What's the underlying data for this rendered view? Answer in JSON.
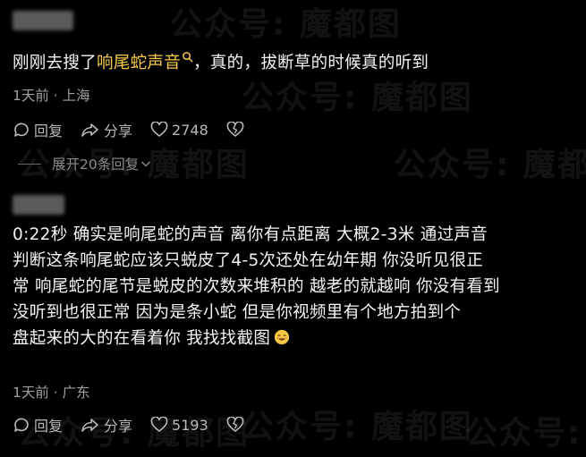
{
  "comments": [
    {
      "text_before": "刚刚去搜了",
      "link_text": "响尾蛇声音",
      "text_after": "，真的，拔断草的时候真的听到",
      "meta": "1天前 · 上海",
      "reply_label": "回复",
      "share_label": "分享",
      "like_count": "2748",
      "expand_label": "展开20条回复"
    },
    {
      "lines": [
        "0:22秒  确实是响尾蛇的声音  离你有点距离  大概2-3米  通过声音",
        "判断这条响尾蛇应该只蜕皮了4-5次还处在幼年期  你没听见很正",
        "常  响尾蛇的尾节是蜕皮的次数来堆积的  越老的就越响  你没有看到",
        "没听到也很正常  因为是条小蛇  但是你视频里有个地方拍到个",
        "盘起来的大的在看着你  我找找截图"
      ],
      "meta": "1天前 · 广东",
      "reply_label": "回复",
      "share_label": "分享",
      "like_count": "5193"
    }
  ],
  "watermark": "公众号: 魔都图",
  "colors": {
    "highlight": "#f6c84a",
    "meta": "#a0a0a0",
    "background": "#000000"
  }
}
